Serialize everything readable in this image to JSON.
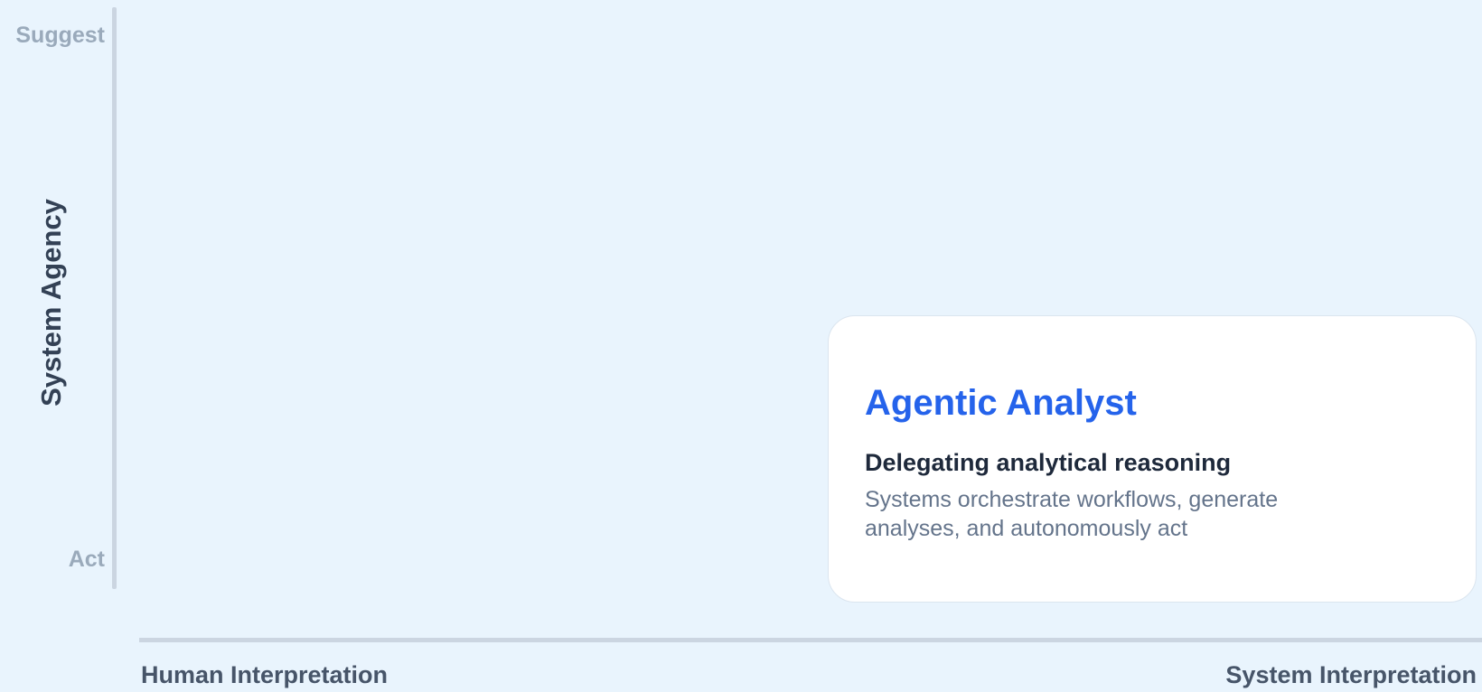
{
  "y_axis": {
    "title": "System Agency",
    "top_label": "Suggest",
    "bottom_label": "Act"
  },
  "x_axis": {
    "left_label": "Human Interpretation",
    "right_label": "System Interpretation"
  },
  "card": {
    "title": "Agentic Analyst",
    "subtitle": "Delegating analytical reasoning",
    "description": "Systems orchestrate workflows, generate analyses, and autonomously act"
  },
  "colors": {
    "background": "#e9f4fd",
    "accent": "#2563eb",
    "axis": "#cbd5e1"
  }
}
